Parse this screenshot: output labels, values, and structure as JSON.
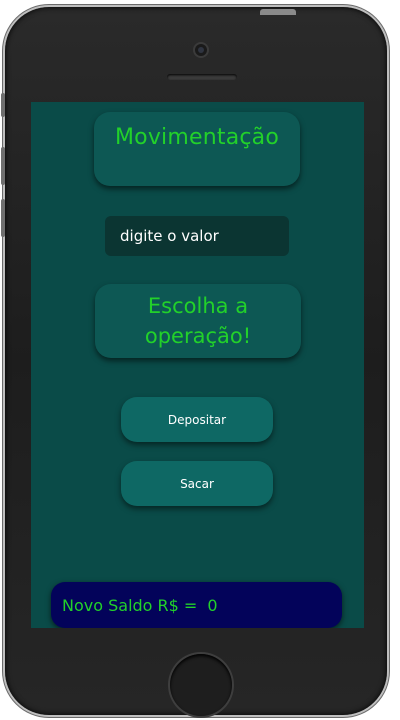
{
  "screen": {
    "title": "Movimentação",
    "amount_input": {
      "placeholder": "digite o valor",
      "value": ""
    },
    "operation_prompt": {
      "line1": "Escolha a",
      "line2": "operação!"
    },
    "buttons": {
      "deposit": "Depositar",
      "withdraw": "Sacar"
    },
    "balance": {
      "label": "Novo Saldo R$ =",
      "value": "0"
    }
  },
  "colors": {
    "screen_background": "#0a4b48",
    "accent_text": "#22d12a",
    "button_background": "#0e6864",
    "balance_background": "#03035a",
    "phone_body": "#1f1f1f"
  },
  "icons": {
    "camera": "front-camera-icon",
    "speaker": "speaker-grille-icon",
    "home": "home-button-icon"
  }
}
